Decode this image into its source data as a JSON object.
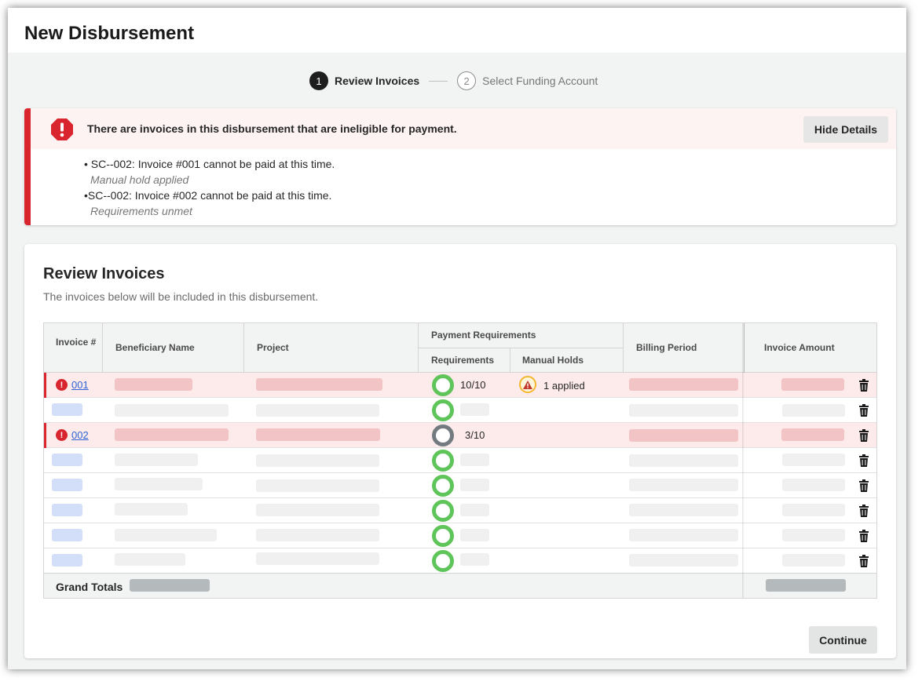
{
  "window": {
    "title": "New Disbursement"
  },
  "stepper": {
    "steps": [
      {
        "number": "1",
        "label": "Review Invoices",
        "state": "active"
      },
      {
        "number": "2",
        "label": "Select Funding Account",
        "state": "inactive"
      }
    ]
  },
  "alert": {
    "message": "There are invoices in this disbursement that are ineligible for payment.",
    "hide_details_label": "Hide Details",
    "items": [
      {
        "title": "• SC--002: Invoice #001 cannot be paid at this time.",
        "reason": "Manual hold applied"
      },
      {
        "title": "•SC--002: Invoice #002 cannot be paid at this time.",
        "reason": "Requirements unmet"
      }
    ],
    "colors": {
      "bar": "#d9262e",
      "header_bg": "#fcf3f2"
    }
  },
  "review": {
    "title": "Review Invoices",
    "description": "The invoices below will be included in this disbursement.",
    "table": {
      "headers": {
        "invoice": "Invoice #",
        "beneficiary": "Beneficiary Name",
        "project": "Project",
        "payment_requirements": "Payment Requirements",
        "requirements": "Requirements",
        "manual_holds": "Manual Holds",
        "billing_period": "Billing Period",
        "invoice_amount": "Invoice Amount"
      },
      "rows": [
        {
          "invoice": "001",
          "error": true,
          "requirements_status": "complete",
          "requirements_text": "10/10",
          "manual_holds": "1 applied"
        },
        {
          "invoice": "",
          "error": false,
          "requirements_status": "complete",
          "requirements_text": "",
          "manual_holds": ""
        },
        {
          "invoice": "002",
          "error": true,
          "requirements_status": "incomplete",
          "requirements_text": "3/10",
          "manual_holds": ""
        },
        {
          "invoice": "",
          "error": false,
          "requirements_status": "complete",
          "requirements_text": "",
          "manual_holds": ""
        },
        {
          "invoice": "",
          "error": false,
          "requirements_status": "complete",
          "requirements_text": "",
          "manual_holds": ""
        },
        {
          "invoice": "",
          "error": false,
          "requirements_status": "complete",
          "requirements_text": "",
          "manual_holds": ""
        },
        {
          "invoice": "",
          "error": false,
          "requirements_status": "complete",
          "requirements_text": "",
          "manual_holds": ""
        },
        {
          "invoice": "",
          "error": false,
          "requirements_status": "complete",
          "requirements_text": "",
          "manual_holds": ""
        }
      ],
      "totals_label": "Grand Totals"
    },
    "continue_label": "Continue"
  },
  "icons": {
    "alert": "octagon-exclamation-icon",
    "row_error": "exclamation-circle-icon",
    "hold": "warning-triangle-icon",
    "delete": "trash-icon"
  },
  "colors": {
    "complete_ring": "#5fc45a",
    "incomplete_ring": "#737b80",
    "link": "#2f63d6",
    "error": "#d9262e"
  }
}
